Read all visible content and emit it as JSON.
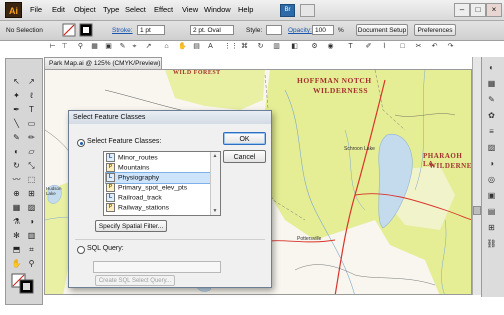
{
  "app": {
    "logo": "Ai"
  },
  "menu": {
    "items": [
      "File",
      "Edit",
      "Object",
      "Type",
      "Select",
      "Effect",
      "View",
      "Window",
      "Help"
    ],
    "bridge_label": "Br"
  },
  "control_bar": {
    "selection": "No Selection",
    "stroke_label": "Stroke:",
    "stroke_value": "1 pt",
    "brush_value": "2 pt. Oval",
    "style_label": "Style:",
    "opacity_label": "Opacity:",
    "opacity_value": "100",
    "opacity_unit": "%",
    "document_setup": "Document Setup",
    "preferences": "Preferences"
  },
  "document": {
    "tab_label": "Park Map.ai @ 125% (CMYK/Preview)"
  },
  "map": {
    "labels": {
      "wild_forest": "WILD FOREST",
      "hoffman_1": "HOFFMAN NOTCH",
      "hoffman_2": "WILDERNESS",
      "pharaoh_1": "PHARAOH LA",
      "pharaoh_2": "WILDERNES",
      "schroon": "Schroon Lake",
      "hudson": "Hudson Lake",
      "pottersville": "Pottersville"
    }
  },
  "dialog": {
    "title": "Select Feature Classes",
    "select_label": "Select Feature Classes:",
    "ok": "OK",
    "cancel": "Cancel",
    "list": [
      {
        "type": "L",
        "name": "Minor_routes",
        "selected": false
      },
      {
        "type": "P",
        "name": "Mountains",
        "selected": false
      },
      {
        "type": "L",
        "name": "Physiography",
        "selected": true
      },
      {
        "type": "P",
        "name": "Primary_spot_elev_pts",
        "selected": false
      },
      {
        "type": "L",
        "name": "Railroad_track",
        "selected": false
      },
      {
        "type": "P",
        "name": "Railway_stations",
        "selected": false
      }
    ],
    "spatial_filter": "Specify Spatial Filter...",
    "sql_label": "SQL Query:",
    "sql_button": "Create SQL Select Query..."
  },
  "colors": {
    "forest": "#e4ec8f",
    "water": "#c4dbed",
    "road": "#d9332b",
    "label": "#a3322f"
  }
}
